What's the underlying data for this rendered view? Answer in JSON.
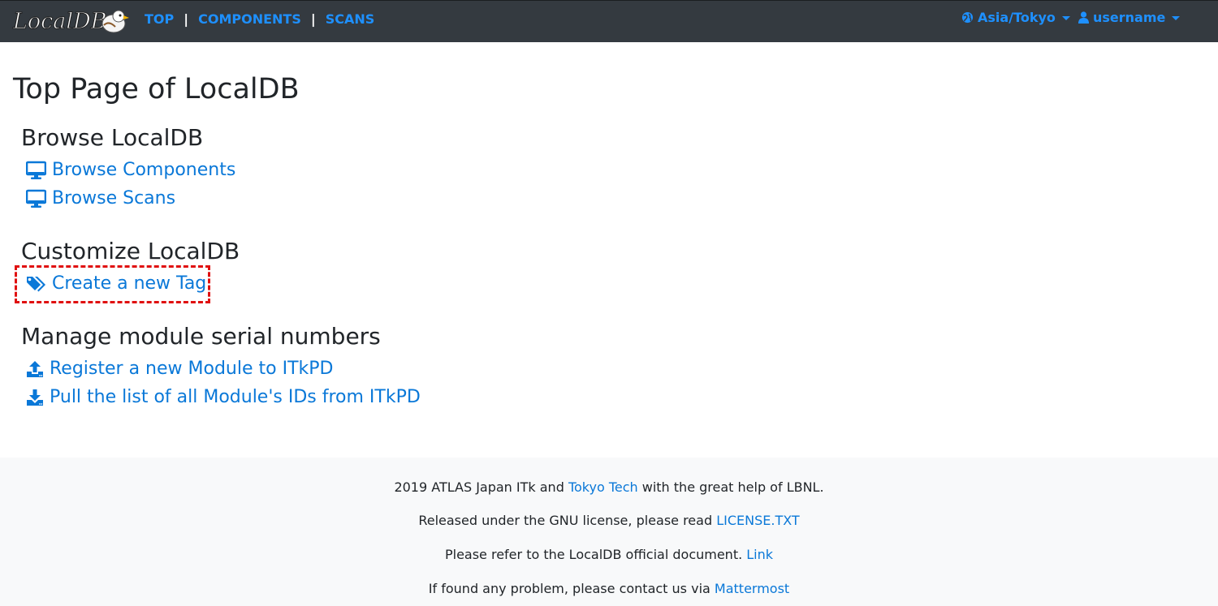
{
  "navbar": {
    "brand": "LocalDB",
    "links": [
      {
        "label": "TOP"
      },
      {
        "label": "COMPONENTS"
      },
      {
        "label": "SCANS"
      }
    ],
    "separator": "|",
    "timezone": "Asia/Tokyo",
    "user": "username"
  },
  "main": {
    "title": "Top Page of LocalDB",
    "sections": [
      {
        "title": "Browse LocalDB",
        "links": [
          {
            "label": "Browse Components",
            "icon": "desktop-icon"
          },
          {
            "label": "Browse Scans",
            "icon": "desktop-icon"
          }
        ]
      },
      {
        "title": "Customize LocalDB",
        "links": [
          {
            "label": "Create a new Tag",
            "icon": "tags-icon"
          }
        ]
      },
      {
        "title": "Manage module serial numbers",
        "links": [
          {
            "label": "Register a new Module to ITkPD",
            "icon": "upload-icon"
          },
          {
            "label": "Pull the list of all Module's IDs from ITkPD",
            "icon": "download-icon"
          }
        ]
      }
    ]
  },
  "footer": {
    "line1": {
      "before": "2019 ATLAS Japan ITk and ",
      "link": "Tokyo Tech",
      "after": " with the great help of LBNL."
    },
    "line2": {
      "before": "Released under the GNU license, please read ",
      "link": "LICENSE.TXT"
    },
    "line3": {
      "before": "Please refer to the LocalDB official document. ",
      "link": "Link"
    },
    "line4": {
      "before": "If found any problem, please contact us via ",
      "link": "Mattermost"
    }
  },
  "colors": {
    "navbar_bg": "#343a40",
    "link": "#0a78d8",
    "nav_link": "#1e90ff",
    "highlight": "#e01010",
    "footer_bg": "#f8f9fa"
  }
}
